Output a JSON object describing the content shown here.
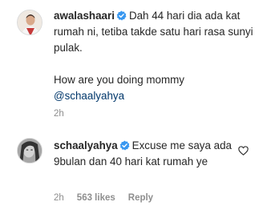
{
  "comments": [
    {
      "username": "awalashaari",
      "text_line1": "Dah 44 hari dia ada kat rumah ni, tetiba takde satu hari rasa sunyi pulak.",
      "text_line2": "How are you doing mommy",
      "mention": "@schaalyahya",
      "time": "2h"
    },
    {
      "username": "schaalyahya",
      "text": "Excuse me saya ada 9bulan dan 40 hari kat rumah ye",
      "time": "2h",
      "likes": "563 likes",
      "reply": "Reply"
    }
  ],
  "colors": {
    "verified": "#3897f0",
    "mention": "#00376b",
    "meta": "#8e8e8e"
  },
  "icons": {
    "verified": "verified-badge-icon",
    "like": "heart-outline-icon"
  }
}
